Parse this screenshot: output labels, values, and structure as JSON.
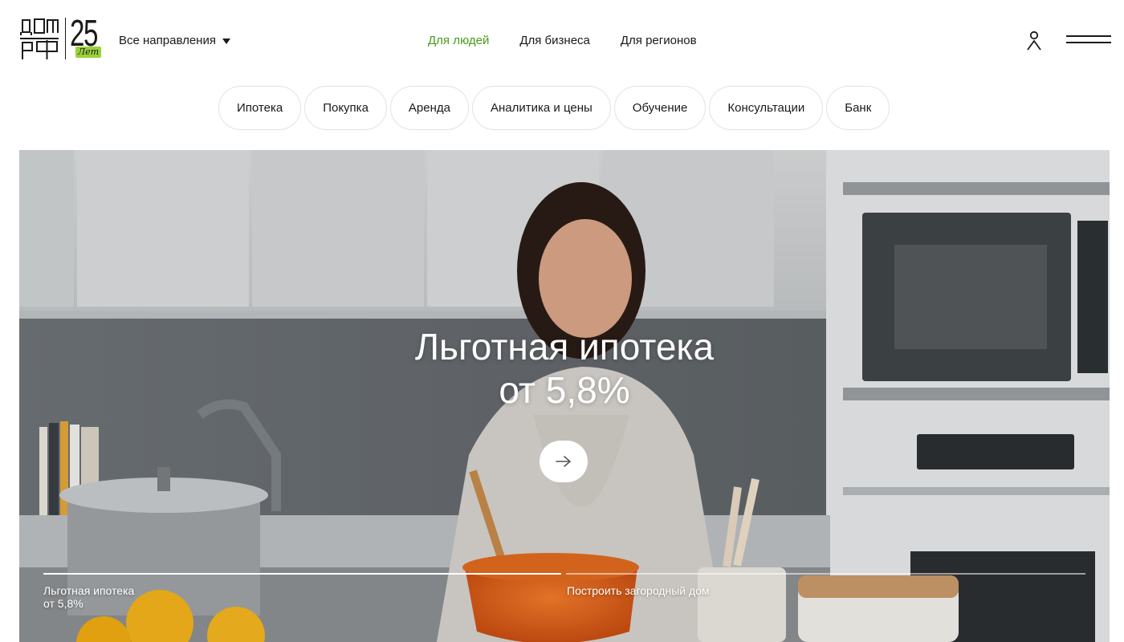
{
  "header": {
    "logo": {
      "text": "ДОМ РФ",
      "anniversary": "25",
      "anniversary_word": "Лет"
    },
    "directions_label": "Все направления",
    "audience_links": [
      {
        "label": "Для людей",
        "active": true
      },
      {
        "label": "Для бизнеса",
        "active": false
      },
      {
        "label": "Для регионов",
        "active": false
      }
    ],
    "icons": {
      "user": "user-icon",
      "menu": "hamburger-menu-icon",
      "caret": "caret-down-icon"
    }
  },
  "tabs": [
    "Ипотека",
    "Покупка",
    "Аренда",
    "Аналитика и цены",
    "Обучение",
    "Консультации",
    "Банк"
  ],
  "hero": {
    "title_line1": "Льготная ипотека",
    "title_line2": "от 5,8%",
    "arrow_icon": "arrow-right-icon",
    "slides": [
      {
        "line1": "Льготная ипотека",
        "line2": "от 5,8%"
      },
      {
        "line1": "Построить загородный дом",
        "line2": ""
      }
    ],
    "progress": [
      1,
      0
    ]
  },
  "colors": {
    "accent_green": "#4a9a1c",
    "logo_badge_green": "#9bd13a",
    "text": "#1a1a1a",
    "tab_border": "#e3e3e3"
  }
}
